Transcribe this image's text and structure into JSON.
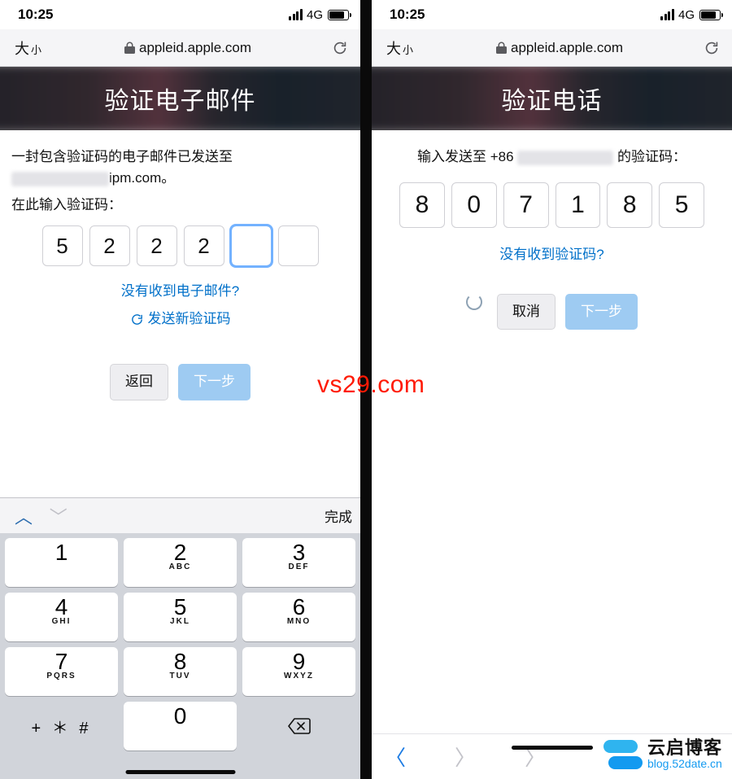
{
  "status": {
    "time": "10:25",
    "net": "4G"
  },
  "urlbar": {
    "aa_big": "大",
    "aa_small": "小",
    "domain": "appleid.apple.com"
  },
  "left": {
    "title": "验证电子邮件",
    "line1": "一封包含验证码的电子邮件已发送至",
    "email_suffix": "ipm.com。",
    "line2": "在此输入验证码：",
    "codes": [
      "5",
      "2",
      "2",
      "2",
      "",
      ""
    ],
    "link_noemail": "没有收到电子邮件?",
    "link_resend": "发送新验证码",
    "btn_back": "返回",
    "btn_next": "下一步",
    "kb_done": "完成",
    "keypad": [
      {
        "n": "1",
        "l": ""
      },
      {
        "n": "2",
        "l": "ABC"
      },
      {
        "n": "3",
        "l": "DEF"
      },
      {
        "n": "4",
        "l": "GHI"
      },
      {
        "n": "5",
        "l": "JKL"
      },
      {
        "n": "6",
        "l": "MNO"
      },
      {
        "n": "7",
        "l": "PQRS"
      },
      {
        "n": "8",
        "l": "TUV"
      },
      {
        "n": "9",
        "l": "WXYZ"
      }
    ],
    "key_symbols": "+ ＊ #",
    "key_zero": "0"
  },
  "right": {
    "title": "验证电话",
    "line1a": "输入发送至 +86",
    "line1b": "的验证码：",
    "codes": [
      "8",
      "0",
      "7",
      "1",
      "8",
      "5"
    ],
    "link_nocode": "没有收到验证码?",
    "btn_cancel": "取消",
    "btn_next": "下一步"
  },
  "overlay": {
    "red": "vs29.com"
  },
  "watermark": {
    "t1": "云启博客",
    "t2": "blog.52date.cn"
  }
}
